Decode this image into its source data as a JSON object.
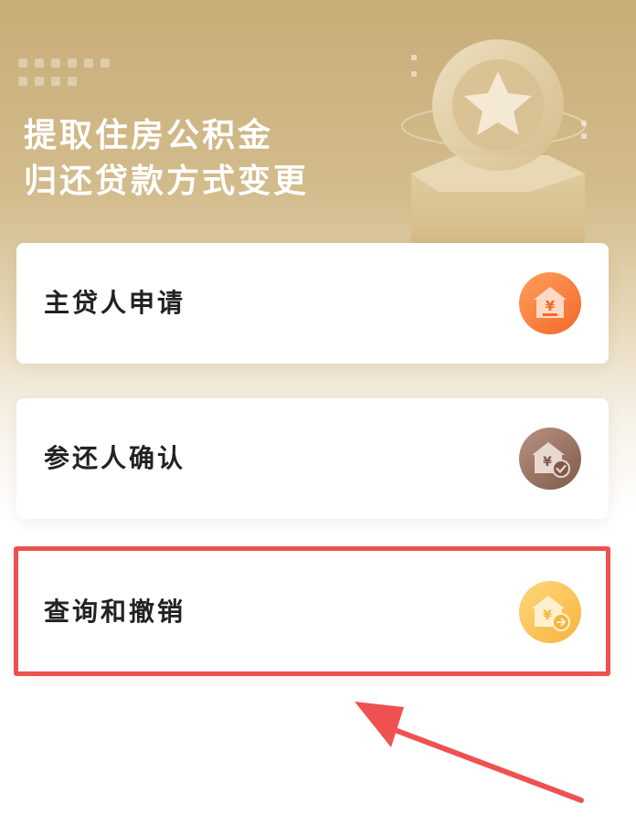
{
  "header": {
    "title_line1": "提取住房公积金",
    "title_line2": "归还贷款方式变更"
  },
  "options": [
    {
      "label": "主贷人申请",
      "icon": "house-yen-icon",
      "icon_color": "#f47a35"
    },
    {
      "label": "参还人确认",
      "icon": "house-yen-check-icon",
      "icon_color": "#9a715f"
    },
    {
      "label": "查询和撤销",
      "icon": "house-yen-search-icon",
      "icon_color": "#f7c45b"
    }
  ],
  "annotation": {
    "highlight_color": "#ef5151",
    "highlighted_option": "查询和撤销"
  },
  "colors": {
    "hero_gold": "#c8ad78",
    "card_background": "#ffffff",
    "text_dark": "#222222"
  }
}
